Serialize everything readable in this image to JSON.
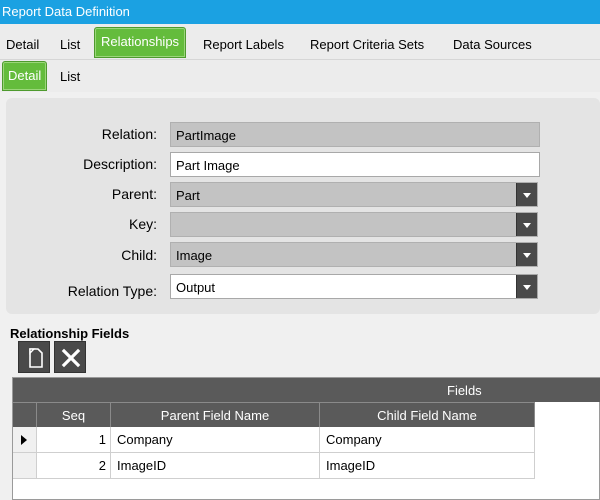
{
  "window": {
    "title": "Report Data Definition"
  },
  "tabs_main": [
    "Detail",
    "List",
    "Relationships",
    "Report Labels",
    "Report Criteria Sets",
    "Data Sources"
  ],
  "tabs_sub": [
    "Detail",
    "List"
  ],
  "form": {
    "relation_label": "Relation:",
    "relation_value": "PartImage",
    "description_label": "Description:",
    "description_value": "Part Image",
    "parent_label": "Parent:",
    "parent_value": "Part",
    "key_label": "Key:",
    "key_value": "",
    "child_label": "Child:",
    "child_value": "Image",
    "relation_type_label": "Relation Type:",
    "relation_type_value": "Output"
  },
  "fields_section": {
    "title": "Relationship Fields"
  },
  "grid": {
    "band_header": "Fields",
    "columns": [
      "Seq",
      "Parent Field Name",
      "Child Field Name"
    ],
    "rows": [
      {
        "seq": "1",
        "parent": "Company",
        "child": "Company"
      },
      {
        "seq": "2",
        "parent": "ImageID",
        "child": "ImageID"
      }
    ]
  },
  "colors": {
    "titlebar": "#1ba1e2",
    "active_tab": "#64bc3c",
    "dark_button": "#4a4a4a"
  },
  "icons": {
    "new_button": "new-document-icon",
    "delete_button": "delete-x-icon",
    "row_selector": "row-pointer-icon"
  }
}
